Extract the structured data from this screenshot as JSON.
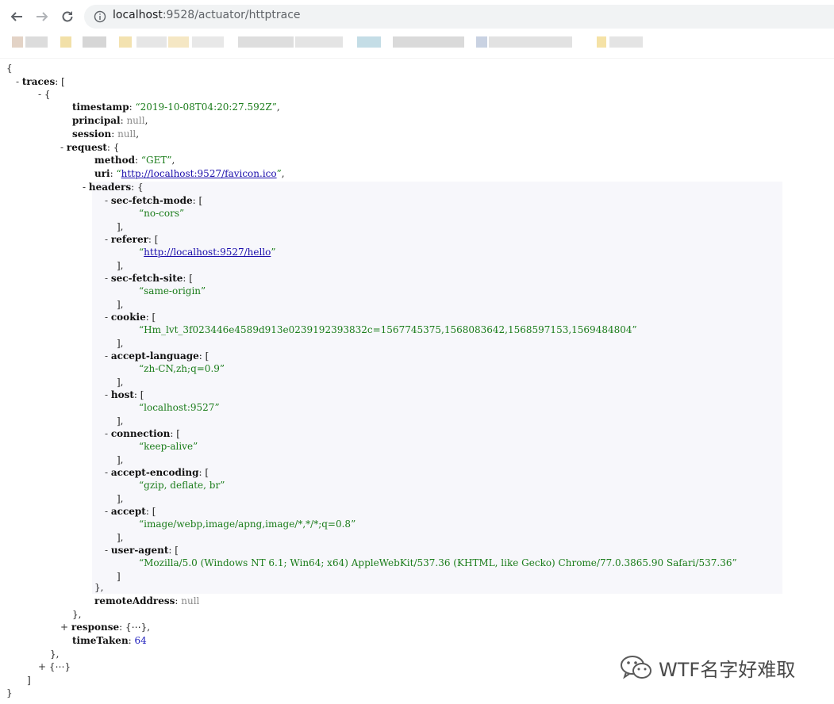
{
  "browser": {
    "url_host": "localhost",
    "url_rest": ":9528/actuator/httptrace"
  },
  "json": {
    "open_brace": "{",
    "traces_key": "traces",
    "trace": {
      "timestamp_key": "timestamp",
      "timestamp_val": "“2019-10-08T04:20:27.592Z”",
      "principal_key": "principal",
      "session_key": "session",
      "null_val": "null",
      "request_key": "request",
      "method_key": "method",
      "method_val": "“GET”",
      "uri_key": "uri",
      "uri_val": "http://localhost:9527/favicon.ico",
      "headers_key": "headers",
      "headers": [
        {
          "key": "sec-fetch-mode",
          "value": "no-cors",
          "link": false
        },
        {
          "key": "referer",
          "value": "http://localhost:9527/hello",
          "link": true
        },
        {
          "key": "sec-fetch-site",
          "value": "same-origin",
          "link": false
        },
        {
          "key": "cookie",
          "value": "Hm_lvt_3f023446e4589d913e0239192393832c=1567745375,1568083642,1568597153,1569484804",
          "link": false
        },
        {
          "key": "accept-language",
          "value": "zh-CN,zh;q=0.9",
          "link": false
        },
        {
          "key": "host",
          "value": "localhost:9527",
          "link": false
        },
        {
          "key": "connection",
          "value": "keep-alive",
          "link": false
        },
        {
          "key": "accept-encoding",
          "value": "gzip, deflate, br",
          "link": false
        },
        {
          "key": "accept",
          "value": "image/webp,image/apng,image/*,*/*;q=0.8",
          "link": false
        },
        {
          "key": "user-agent",
          "value": "Mozilla/5.0 (Windows NT 6.1; Win64; x64) AppleWebKit/537.36 (KHTML, like Gecko) Chrome/77.0.3865.90 Safari/537.36",
          "link": false
        }
      ],
      "remote_key": "remoteAddress",
      "response_key": "response",
      "collapsed": "{⋯}",
      "timetaken_key": "timeTaken",
      "timetaken_val": "64"
    }
  },
  "watermark": {
    "text": "WTF名字好难取"
  }
}
